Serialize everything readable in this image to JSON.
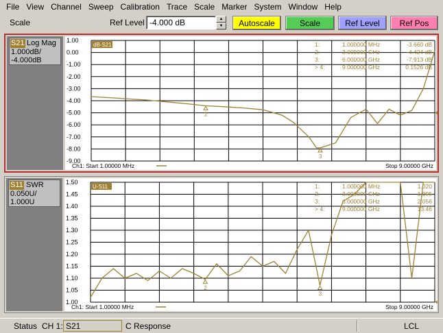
{
  "menu": [
    "File",
    "View",
    "Channel",
    "Sweep",
    "Calibration",
    "Trace",
    "Scale",
    "Marker",
    "System",
    "Window",
    "Help"
  ],
  "toolbar": {
    "scale_label": "Scale",
    "ref_level_label": "Ref Level",
    "ref_level_value": "-4.000 dB",
    "autoscale_label": "Autoscale",
    "scale_button_label": "Scale",
    "ref_level_button_label": "Ref Level",
    "ref_pos_label": "Ref Pos",
    "colors": {
      "autoscale": "#ffff00",
      "scale": "#55cc55",
      "ref_level": "#a0a0ff",
      "ref_pos": "#ff80b0"
    }
  },
  "trace1": {
    "tag": "S21",
    "format": "Log Mag",
    "scale": "1.000dB/",
    "ref": "-4.000dB",
    "title_box": "dB-S21",
    "start": "Ch1: Start  1.00000 MHz",
    "stop": "Stop  9.00000 GHz",
    "y_ticks": [
      "1.00",
      "0.00",
      "-1.00",
      "-2.00",
      "-3.00",
      "-4.00",
      "-5.00",
      "-6.00",
      "-7.00",
      "-8.00",
      "-9.00"
    ],
    "markers": [
      {
        "id": "1:",
        "freq": "1.000000 MHz",
        "value": "-3.660 dB"
      },
      {
        "id": "2:",
        "freq": "3.000000 GHz",
        "value": "-4.424 dB"
      },
      {
        "id": "3:",
        "freq": "6.000000 GHz",
        "value": "-7.913 dB"
      },
      {
        "id": "> 4:",
        "freq": "9.000000 GHz",
        "value": "0.1526 dB"
      }
    ]
  },
  "trace2": {
    "tag": "S11",
    "format": "SWR",
    "scale": "0.050U/",
    "ref": "1.000U",
    "title_box": "U-S11",
    "start": "Ch1: Start  1.00000 MHz",
    "stop": "Stop  9.00000 GHz",
    "y_ticks": [
      "1.50",
      "1.45",
      "1.40",
      "1.35",
      "1.30",
      "1.25",
      "1.20",
      "1.15",
      "1.10",
      "1.05",
      "1.00"
    ],
    "markers": [
      {
        "id": "1:",
        "freq": "1.000000 MHz",
        "value": "1.020"
      },
      {
        "id": "2:",
        "freq": "3.000000 GHz",
        "value": "1.095"
      },
      {
        "id": "3:",
        "freq": "6.000000 GHz",
        "value": "2.056"
      },
      {
        "id": "> 4:",
        "freq": "9.000000 GHz",
        "value": "13.46"
      }
    ]
  },
  "status": {
    "label": "Status",
    "channel": "CH 1:",
    "param": "S21",
    "c": "C",
    "response": "Response",
    "lcl": "LCL"
  },
  "colors": {
    "trace": "#a08030",
    "grid": "#000000",
    "plot_bg": "#ffffff",
    "marker_text": "#a08030"
  },
  "chart_data": [
    {
      "type": "line",
      "title": "dB-S21",
      "xlabel": "",
      "ylabel": "",
      "xlim": [
        0.001,
        9.0
      ],
      "ylim": [
        -9.0,
        1.0
      ],
      "x": [
        0.001,
        0.5,
        1.0,
        1.5,
        2.0,
        2.5,
        3.0,
        3.5,
        4.0,
        4.5,
        5.0,
        5.3,
        5.5,
        5.7,
        5.9,
        6.0,
        6.4,
        6.8,
        7.2,
        7.5,
        7.8,
        8.1,
        8.4,
        8.7,
        9.0
      ],
      "series": [
        {
          "values": [
            -3.66,
            -3.75,
            -3.85,
            -3.95,
            -4.1,
            -4.25,
            -4.42,
            -4.5,
            -4.6,
            -4.75,
            -5.2,
            -5.8,
            -6.4,
            -7.0,
            -7.9,
            -7.91,
            -7.5,
            -5.4,
            -4.7,
            -5.9,
            -4.7,
            -5.2,
            -4.8,
            -3.0,
            0.15
          ]
        }
      ]
    },
    {
      "type": "line",
      "title": "U-S11",
      "xlabel": "",
      "ylabel": "",
      "xlim": [
        0.001,
        9.0
      ],
      "ylim": [
        1.0,
        1.5
      ],
      "x": [
        0.001,
        0.3,
        0.6,
        0.9,
        1.2,
        1.5,
        1.8,
        2.1,
        2.4,
        2.7,
        3.0,
        3.3,
        3.6,
        3.9,
        4.2,
        4.5,
        4.8,
        5.1,
        5.4,
        5.7,
        6.0,
        6.3,
        6.6,
        6.9,
        7.2,
        7.5,
        7.8,
        8.1,
        8.4,
        8.7,
        9.0
      ],
      "series": [
        {
          "values": [
            1.02,
            1.1,
            1.14,
            1.1,
            1.12,
            1.09,
            1.13,
            1.1,
            1.14,
            1.12,
            1.095,
            1.16,
            1.11,
            1.13,
            1.19,
            1.15,
            1.17,
            1.12,
            1.22,
            1.3,
            1.07,
            1.28,
            1.42,
            1.45,
            1.5,
            1.5,
            1.5,
            1.5,
            1.1,
            1.5,
            1.5
          ]
        }
      ]
    }
  ]
}
